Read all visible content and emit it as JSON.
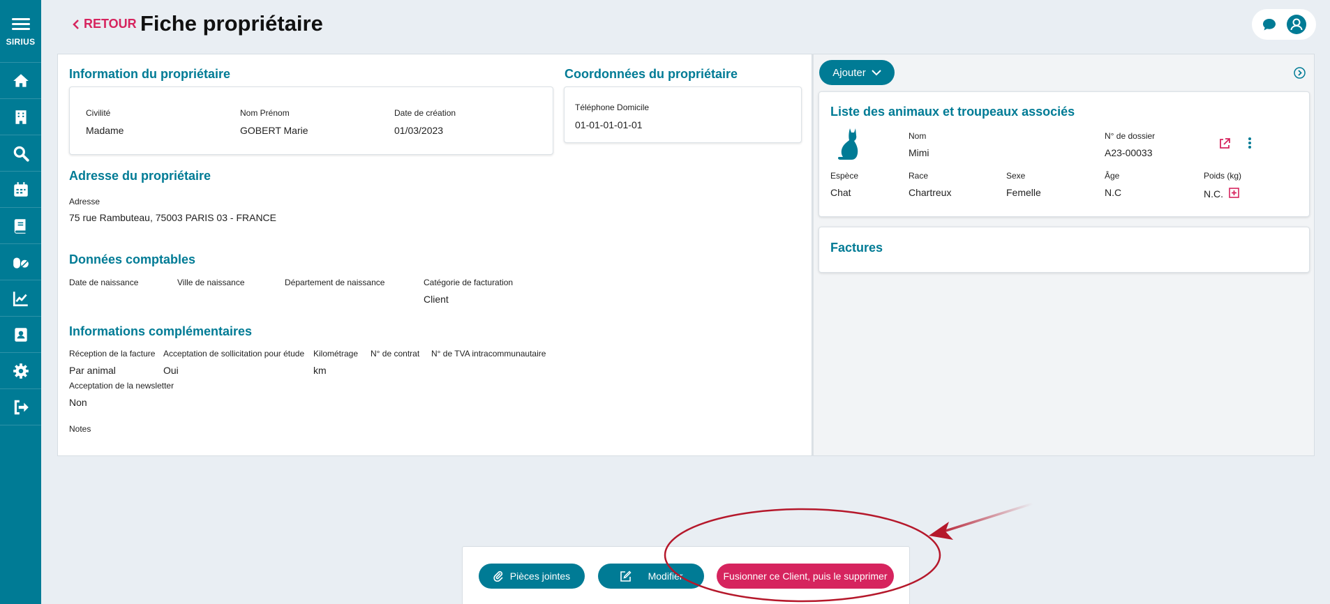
{
  "sidebar": {
    "brand": "SIRIUS",
    "items": [
      {
        "icon": "home-icon"
      },
      {
        "icon": "building-icon"
      },
      {
        "icon": "search-icon"
      },
      {
        "icon": "calendar-icon"
      },
      {
        "icon": "book-icon"
      },
      {
        "icon": "pills-icon"
      },
      {
        "icon": "chart-icon"
      },
      {
        "icon": "contact-book-icon"
      },
      {
        "icon": "gear-icon"
      },
      {
        "icon": "logout-icon"
      }
    ]
  },
  "header": {
    "back_label": "RETOUR",
    "title": "Fiche propriétaire"
  },
  "owner_info": {
    "title": "Information du propriétaire",
    "civilite_label": "Civilité",
    "civilite_value": "Madame",
    "nom_label": "Nom Prénom",
    "nom_value": "GOBERT Marie",
    "date_label": "Date de création",
    "date_value": "01/03/2023"
  },
  "contact": {
    "title": "Coordonnées du propriétaire",
    "phone_label": "Téléphone Domicile",
    "phone_value": "01-01-01-01-01"
  },
  "address": {
    "title": "Adresse du propriétaire",
    "label": "Adresse",
    "value": "75 rue Rambuteau, 75003 PARIS 03 - FRANCE"
  },
  "accounting": {
    "title": "Données comptables",
    "birth_date_label": "Date de naissance",
    "birth_city_label": "Ville de naissance",
    "birth_dept_label": "Département de naissance",
    "billing_cat_label": "Catégorie de facturation",
    "billing_cat_value": "Client"
  },
  "extra": {
    "title": "Informations complémentaires",
    "invoice_label": "Réception de la facture",
    "invoice_value": "Par animal",
    "study_label": "Acceptation de sollicitation pour étude",
    "study_value": "Oui",
    "km_label": "Kilométrage",
    "km_value": "km",
    "contract_label": "N° de contrat",
    "vat_label": "N° de TVA intracommunautaire",
    "newsletter_label": "Acceptation de la newsletter",
    "newsletter_value": "Non",
    "notes_label": "Notes"
  },
  "right_panel": {
    "add_button": "Ajouter",
    "animals_title": "Liste des animaux et troupeaux associés",
    "animal": {
      "nom_label": "Nom",
      "nom_value": "Mimi",
      "dossier_label": "N° de dossier",
      "dossier_value": "A23-00033",
      "espece_label": "Espèce",
      "espece_value": "Chat",
      "race_label": "Race",
      "race_value": "Chartreux",
      "sexe_label": "Sexe",
      "sexe_value": "Femelle",
      "age_label": "Âge",
      "age_value": "N.C",
      "poids_label": "Poids (kg)",
      "poids_value": "N.C."
    },
    "invoices_title": "Factures"
  },
  "actions": {
    "attachments": "Pièces jointes",
    "edit": "Modifier",
    "merge": "Fusionner ce Client, puis le supprimer"
  },
  "colors": {
    "primary": "#007b95",
    "accent": "#d6245e",
    "annotation": "#b5182b"
  }
}
